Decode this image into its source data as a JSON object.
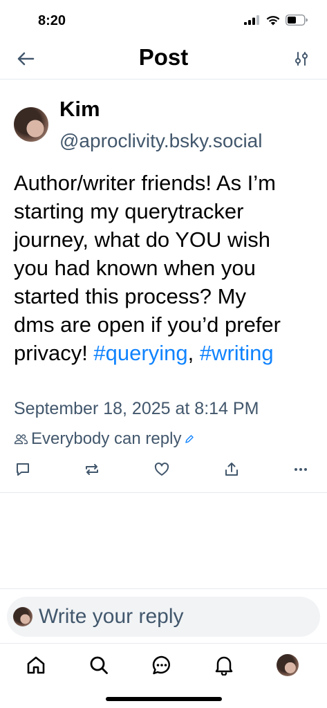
{
  "status_bar": {
    "time": "8:20"
  },
  "header": {
    "title": "Post"
  },
  "post": {
    "display_name": "Kim",
    "handle": "@aproclivity.bsky.social",
    "text_line_1": "Author/writer friends! As I’m",
    "text_line_2": "starting my querytracker",
    "text_line_3": "journey, what do YOU wish",
    "text_line_4": "you had known when you",
    "text_line_5": "started this process? My",
    "text_line_6": "dms are open if you’d prefer",
    "text_line_7_prefix": "privacy! ",
    "hashtag_1": "#querying",
    "separator": ", ",
    "hashtag_2": "#writing",
    "timestamp": "September 18, 2025 at 8:14 PM",
    "reply_setting": "Everybody can reply"
  },
  "reply": {
    "placeholder": "Write your reply"
  },
  "colors": {
    "accent": "#1083fe",
    "secondary_text": "#42576c",
    "divider": "#e6eaef"
  }
}
